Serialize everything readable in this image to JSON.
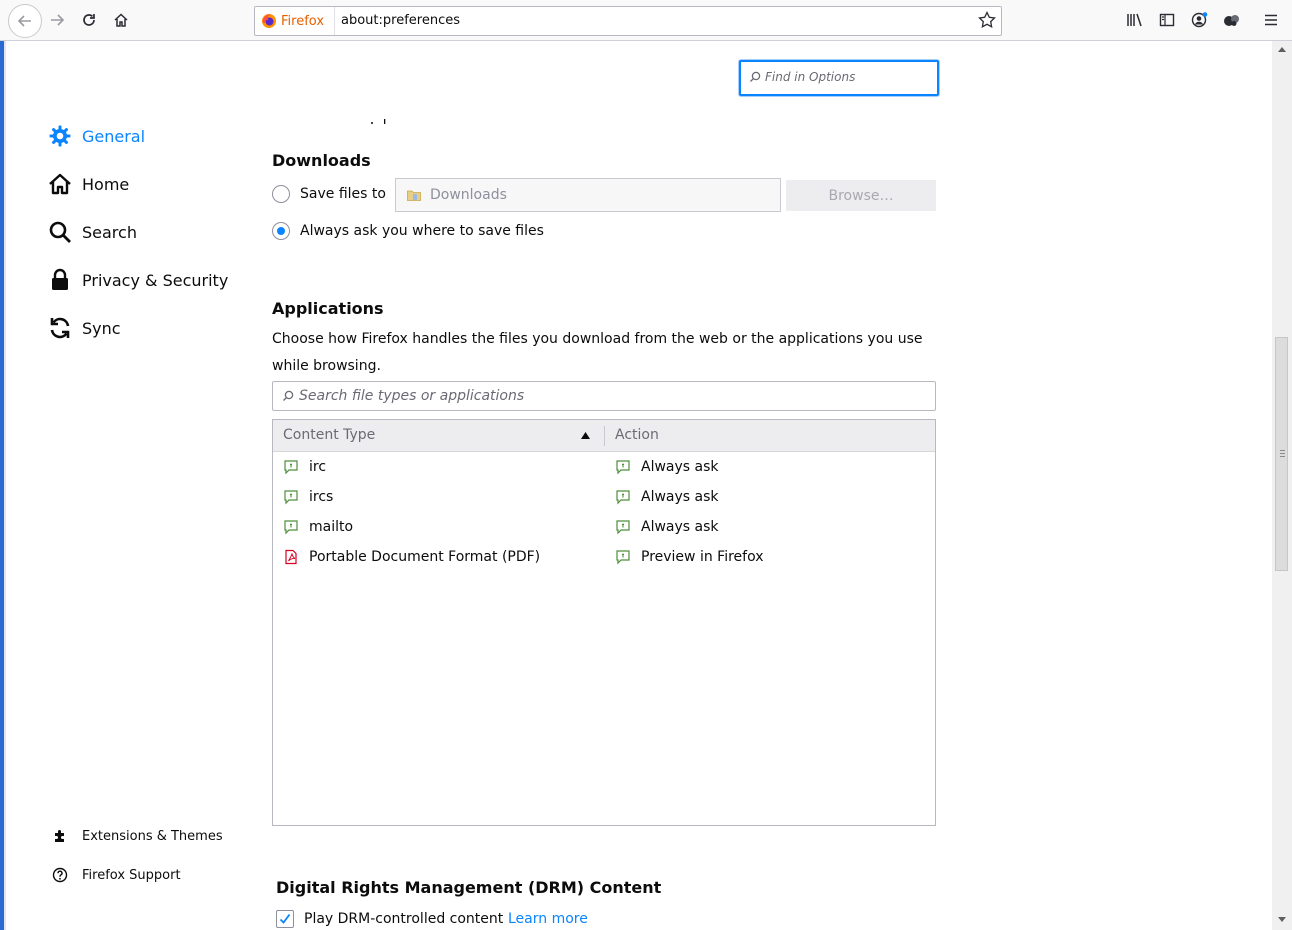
{
  "browser": {
    "identity_label": "Firefox",
    "url": "about:preferences"
  },
  "sidebar": {
    "categories": [
      {
        "label": "General",
        "icon": "gear-icon",
        "selected": true
      },
      {
        "label": "Home",
        "icon": "home-icon"
      },
      {
        "label": "Search",
        "icon": "search-icon"
      },
      {
        "label": "Privacy & Security",
        "icon": "lock-icon"
      },
      {
        "label": "Sync",
        "icon": "sync-icon"
      }
    ],
    "footer": [
      {
        "label": "Extensions & Themes",
        "icon": "puzzle-icon"
      },
      {
        "label": "Firefox Support",
        "icon": "help-icon"
      }
    ]
  },
  "find": {
    "placeholder": "Find in Options"
  },
  "downloads": {
    "heading": "Downloads",
    "save_files_label": "Save files to",
    "folder_name": "Downloads",
    "browse_label": "Browse…",
    "always_ask_label": "Always ask you where to save files",
    "selected_option": "always_ask"
  },
  "applications": {
    "heading": "Applications",
    "description": "Choose how Firefox handles the files you download from the web or the applications you use while browsing.",
    "search_placeholder": "Search file types or applications",
    "columns": {
      "content_type": "Content Type",
      "action": "Action"
    },
    "rows": [
      {
        "type": "irc",
        "type_icon": "chat-icon",
        "action": "Always ask",
        "action_icon": "chat-icon"
      },
      {
        "type": "ircs",
        "type_icon": "chat-icon",
        "action": "Always ask",
        "action_icon": "chat-icon"
      },
      {
        "type": "mailto",
        "type_icon": "chat-icon",
        "action": "Always ask",
        "action_icon": "chat-icon"
      },
      {
        "type": "Portable Document Format (PDF)",
        "type_icon": "pdf-icon",
        "action": "Preview in Firefox",
        "action_icon": "chat-icon"
      }
    ]
  },
  "drm": {
    "heading": "Digital Rights Management (DRM) Content",
    "play_label": "Play DRM-controlled content",
    "play_checked": true,
    "learn_more": "Learn more"
  },
  "colors": {
    "accent": "#0a84ff",
    "frame": "#2a6bd1"
  }
}
